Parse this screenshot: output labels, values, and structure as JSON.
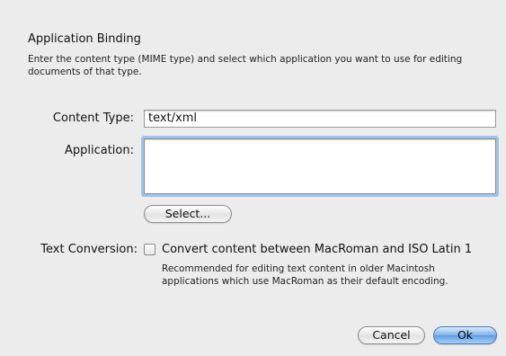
{
  "dialog": {
    "title": "Application Binding",
    "description": "Enter the content type (MIME type) and select which application you want to use for editing documents of that type."
  },
  "form": {
    "content_type_label": "Content Type:",
    "content_type_value": "text/xml",
    "application_label": "Application:",
    "application_value": "",
    "select_button_label": "Select...",
    "text_conversion_label": "Text Conversion:",
    "convert_checkbox_label": "Convert content between MacRoman and ISO Latin 1",
    "convert_checked": false,
    "convert_hint": "Recommended for editing text content in older Macintosh applications which use MacRoman as their default encoding."
  },
  "buttons": {
    "cancel_label": "Cancel",
    "ok_label": "Ok"
  },
  "colors": {
    "background": "#ececec",
    "focus_ring": "#9ec3ef",
    "default_button": "#6fa8e6"
  }
}
